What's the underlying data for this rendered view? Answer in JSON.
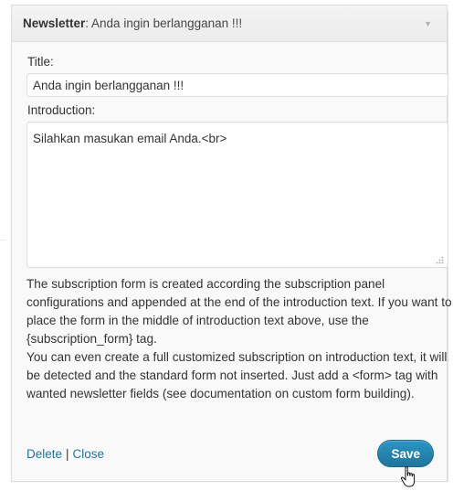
{
  "widget": {
    "title_prefix": "Newsletter",
    "title_instance": ": Anda ingin berlangganan !!!",
    "toggle_glyph": "▼"
  },
  "form": {
    "title_label": "Title:",
    "title_value": "Anda ingin berlangganan !!!",
    "intro_label": "Introduction:",
    "intro_value": "Silahkan masukan email Anda.<br>"
  },
  "help": {
    "paragraph_1": "The subscription form is created according the subscription panel configurations and appended at the end of the introduction text. If you want to place the form in the middle of introduction text above, use the {subscription_form} tag.",
    "paragraph_2": "You can even create a full customized subscription on introduction text, it will be detected and the standard form not inserted. Just add a <form> tag with wanted newsletter fields (see documentation on custom form building)."
  },
  "actions": {
    "delete_label": "Delete",
    "separator": "|",
    "close_label": "Close",
    "save_label": "Save"
  },
  "colors": {
    "link": "#21759b",
    "save_button": "#21759b",
    "panel_bg": "#f9f9f9"
  },
  "cursor": {
    "icon": "hand-pointer-icon"
  }
}
